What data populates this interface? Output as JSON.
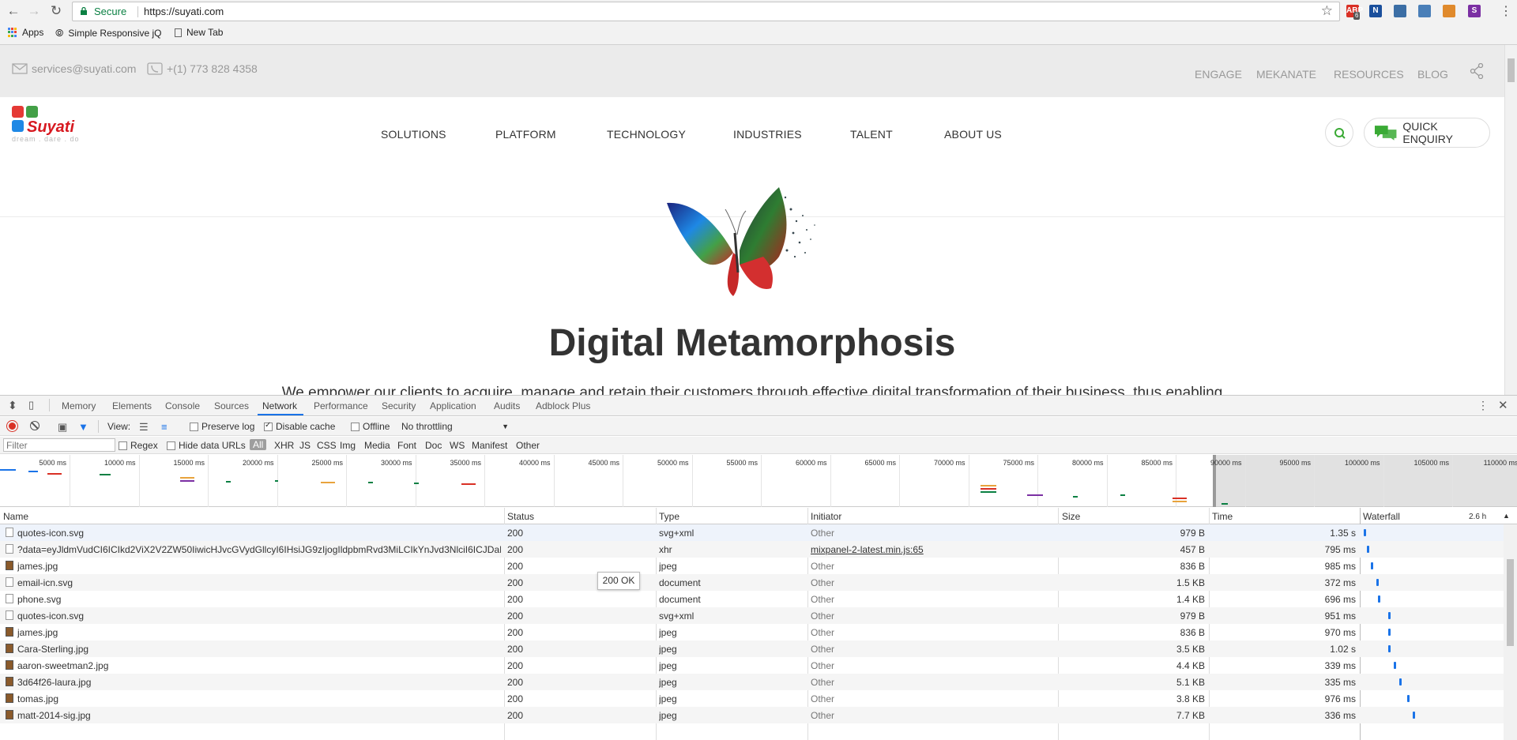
{
  "browser": {
    "url": "https://suyati.com",
    "secure_label": "Secure",
    "bookmarks": [
      {
        "label": "Apps"
      },
      {
        "label": "Simple Responsive jQ"
      },
      {
        "label": "New Tab"
      }
    ],
    "extensions": [
      {
        "name": "adblock-icon",
        "label": "ABP",
        "badge": "6",
        "color": "#d93025"
      },
      {
        "name": "n-extension-icon",
        "label": "N",
        "color": "#1a4f9c"
      },
      {
        "name": "person-extension-icon",
        "label": "",
        "color": "#3b6ea5"
      },
      {
        "name": "screenshot-extension-icon",
        "label": "",
        "color": "#4a7fb8"
      },
      {
        "name": "eyedropper-extension-icon",
        "label": "",
        "color": "#e08a2c"
      },
      {
        "name": "s-extension-icon",
        "label": "S",
        "color": "#7b2fa3"
      }
    ]
  },
  "site": {
    "email": "services@suyati.com",
    "phone": "+(1) 773 828 4358",
    "top_links": [
      "ENGAGE",
      "MEKANATE",
      "RESOURCES",
      "BLOG"
    ],
    "logo_word": "Suyati",
    "logo_tagline": "dream . dare . do",
    "menu": [
      "SOLUTIONS",
      "PLATFORM",
      "TECHNOLOGY",
      "INDUSTRIES",
      "TALENT",
      "ABOUT US"
    ],
    "quick_enquiry": "QUICK ENQUIRY",
    "hero_title": "Digital Metamorphosis",
    "hero_subtitle": "We empower our clients to acquire, manage and retain their customers through effective digital transformation of their business, thus enabling"
  },
  "devtools": {
    "tabs": [
      "Memory",
      "Elements",
      "Console",
      "Sources",
      "Network",
      "Performance",
      "Security",
      "Application",
      "Audits",
      "Adblock Plus"
    ],
    "active_tab": "Network",
    "toolbar": {
      "view_label": "View:",
      "preserve_log": "Preserve log",
      "disable_cache": "Disable cache",
      "offline": "Offline",
      "throttling": "No throttling"
    },
    "filter": {
      "placeholder": "Filter",
      "regex": "Regex",
      "hide_data_urls": "Hide data URLs",
      "types": [
        "All",
        "XHR",
        "JS",
        "CSS",
        "Img",
        "Media",
        "Font",
        "Doc",
        "WS",
        "Manifest",
        "Other"
      ]
    },
    "overview_ticks": [
      "5000 ms",
      "10000 ms",
      "15000 ms",
      "20000 ms",
      "25000 ms",
      "30000 ms",
      "35000 ms",
      "40000 ms",
      "45000 ms",
      "50000 ms",
      "55000 ms",
      "60000 ms",
      "65000 ms",
      "70000 ms",
      "75000 ms",
      "80000 ms",
      "85000 ms",
      "90000 ms",
      "95000 ms",
      "100000 ms",
      "105000 ms",
      "110000 ms"
    ],
    "columns": [
      "Name",
      "Status",
      "Type",
      "Initiator",
      "Size",
      "Time",
      "Waterfall"
    ],
    "waterfall_scale": "2.6 h",
    "tooltip": "200 OK",
    "requests": [
      {
        "name": "quotes-icon.svg",
        "status": "200",
        "type": "svg+xml",
        "initiator": "Other",
        "size": "979 B",
        "time": "1.35 s",
        "icon": "file"
      },
      {
        "name": "?data=eyJldmVudCI6ICIkd2ViX2V2ZW50IiwicHJvcGVydGllcyI6IHsiJG9zIjogIldpbmRvd3MiLCIkYnJvd3NlciI6ICJDaHJv...",
        "status": "200",
        "type": "xhr",
        "initiator": "mixpanel-2-latest.min.js:65",
        "size": "457 B",
        "time": "795 ms",
        "icon": "file"
      },
      {
        "name": "james.jpg",
        "status": "200",
        "type": "jpeg",
        "initiator": "Other",
        "size": "836 B",
        "time": "985 ms",
        "icon": "img"
      },
      {
        "name": "email-icn.svg",
        "status": "200",
        "type": "document",
        "initiator": "Other",
        "size": "1.5 KB",
        "time": "372 ms",
        "icon": "file"
      },
      {
        "name": "phone.svg",
        "status": "200",
        "type": "document",
        "initiator": "Other",
        "size": "1.4 KB",
        "time": "696 ms",
        "icon": "file"
      },
      {
        "name": "quotes-icon.svg",
        "status": "200",
        "type": "svg+xml",
        "initiator": "Other",
        "size": "979 B",
        "time": "951 ms",
        "icon": "file"
      },
      {
        "name": "james.jpg",
        "status": "200",
        "type": "jpeg",
        "initiator": "Other",
        "size": "836 B",
        "time": "970 ms",
        "icon": "img"
      },
      {
        "name": "Cara-Sterling.jpg",
        "status": "200",
        "type": "jpeg",
        "initiator": "Other",
        "size": "3.5 KB",
        "time": "1.02 s",
        "icon": "img"
      },
      {
        "name": "aaron-sweetman2.jpg",
        "status": "200",
        "type": "jpeg",
        "initiator": "Other",
        "size": "4.4 KB",
        "time": "339 ms",
        "icon": "img"
      },
      {
        "name": "3d64f26-laura.jpg",
        "status": "200",
        "type": "jpeg",
        "initiator": "Other",
        "size": "5.1 KB",
        "time": "335 ms",
        "icon": "img"
      },
      {
        "name": "tomas.jpg",
        "status": "200",
        "type": "jpeg",
        "initiator": "Other",
        "size": "3.8 KB",
        "time": "976 ms",
        "icon": "img"
      },
      {
        "name": "matt-2014-sig.jpg",
        "status": "200",
        "type": "jpeg",
        "initiator": "Other",
        "size": "7.7 KB",
        "time": "336 ms",
        "icon": "img"
      }
    ]
  }
}
